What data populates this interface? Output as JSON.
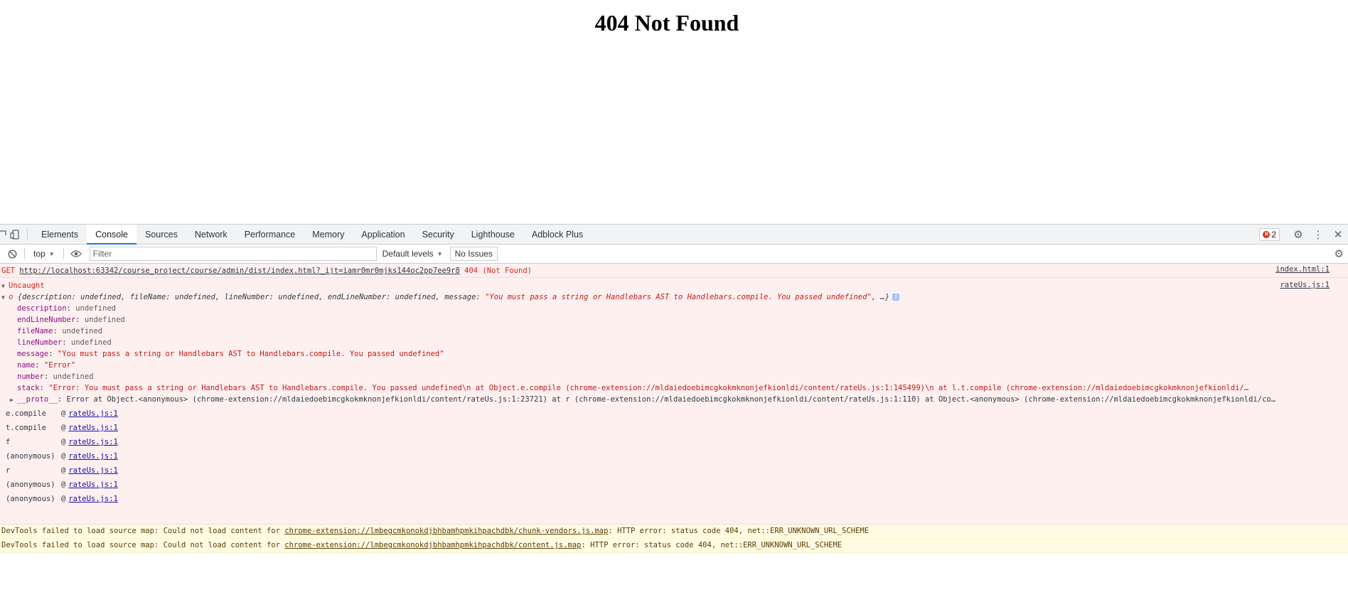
{
  "page": {
    "title": "404 Not Found"
  },
  "devtools": {
    "tabs": [
      "Elements",
      "Console",
      "Sources",
      "Network",
      "Performance",
      "Memory",
      "Application",
      "Security",
      "Lighthouse",
      "Adblock Plus"
    ],
    "active_tab": "Console",
    "error_count": "2",
    "toolbar": {
      "context": "top",
      "filter_placeholder": "Filter",
      "levels": "Default levels",
      "issues": "No Issues"
    },
    "messages": {
      "get_error": {
        "method": "GET",
        "url": "http://localhost:63342/course_project/course/admin/dist/index.html?_ijt=iamr0mr0mjks144oc2pp7ee9r8",
        "status": "404 (Not Found)",
        "source": "index.html:1"
      },
      "uncaught": {
        "label": "Uncaught",
        "source": "rateUs.js:1",
        "object_prefix": "o",
        "object_summary": "{description: undefined, fileName: undefined, lineNumber: undefined, endLineNumber: undefined, message: ",
        "object_summary_msg": "\"You must pass a string or Handlebars AST to Handlebars.compile. You passed undefined\"",
        "object_summary_end": ", …}",
        "info_badge": "i",
        "props": [
          {
            "key": "description",
            "value": "undefined",
            "type": "und"
          },
          {
            "key": "endLineNumber",
            "value": "undefined",
            "type": "und"
          },
          {
            "key": "fileName",
            "value": "undefined",
            "type": "und"
          },
          {
            "key": "lineNumber",
            "value": "undefined",
            "type": "und"
          },
          {
            "key": "message",
            "value": "\"You must pass a string or Handlebars AST to Handlebars.compile. You passed undefined\"",
            "type": "str"
          },
          {
            "key": "name",
            "value": "\"Error\"",
            "type": "str"
          },
          {
            "key": "number",
            "value": "undefined",
            "type": "und"
          },
          {
            "key": "stack",
            "value": "\"Error: You must pass a string or Handlebars AST to Handlebars.compile. You passed undefined\\n    at Object.e.compile (chrome-extension://mldaiedoebimcgkokmknonjefkionldi/content/rateUs.js:1:145499)\\n    at l.t.compile (chrome-extension://mldaiedoebimcgkokmknonjefkionldi/…",
            "type": "str"
          }
        ],
        "proto_key": "__proto__",
        "proto_value": "Error at Object.<anonymous> (chrome-extension://mldaiedoebimcgkokmknonjefkionldi/content/rateUs.js:1:23721) at r (chrome-extension://mldaiedoebimcgkokmknonjefkionldi/content/rateUs.js:1:110) at Object.<anonymous> (chrome-extension://mldaiedoebimcgkokmknonjefkionldi/co…",
        "frames": [
          {
            "fn": "e.compile",
            "link": "rateUs.js:1"
          },
          {
            "fn": "t.compile",
            "link": "rateUs.js:1"
          },
          {
            "fn": "f",
            "link": "rateUs.js:1"
          },
          {
            "fn": "(anonymous)",
            "link": "rateUs.js:1"
          },
          {
            "fn": "r",
            "link": "rateUs.js:1"
          },
          {
            "fn": "(anonymous)",
            "link": "rateUs.js:1"
          },
          {
            "fn": "(anonymous)",
            "link": "rateUs.js:1"
          }
        ],
        "at_symbol": "@"
      },
      "warnings": [
        {
          "prefix": "DevTools failed to load source map: Could not load content for ",
          "url": "chrome-extension://lmbegcmkonokdjbhbamhpmkihpachdbk/chunk-vendors.js.map",
          "suffix": ": HTTP error: status code 404, net::ERR_UNKNOWN_URL_SCHEME"
        },
        {
          "prefix": "DevTools failed to load source map: Could not load content for ",
          "url": "chrome-extension://lmbegcmkonokdjbhbamhpmkihpachdbk/content.js.map",
          "suffix": ": HTTP error: status code 404, net::ERR_UNKNOWN_URL_SCHEME"
        }
      ]
    }
  }
}
